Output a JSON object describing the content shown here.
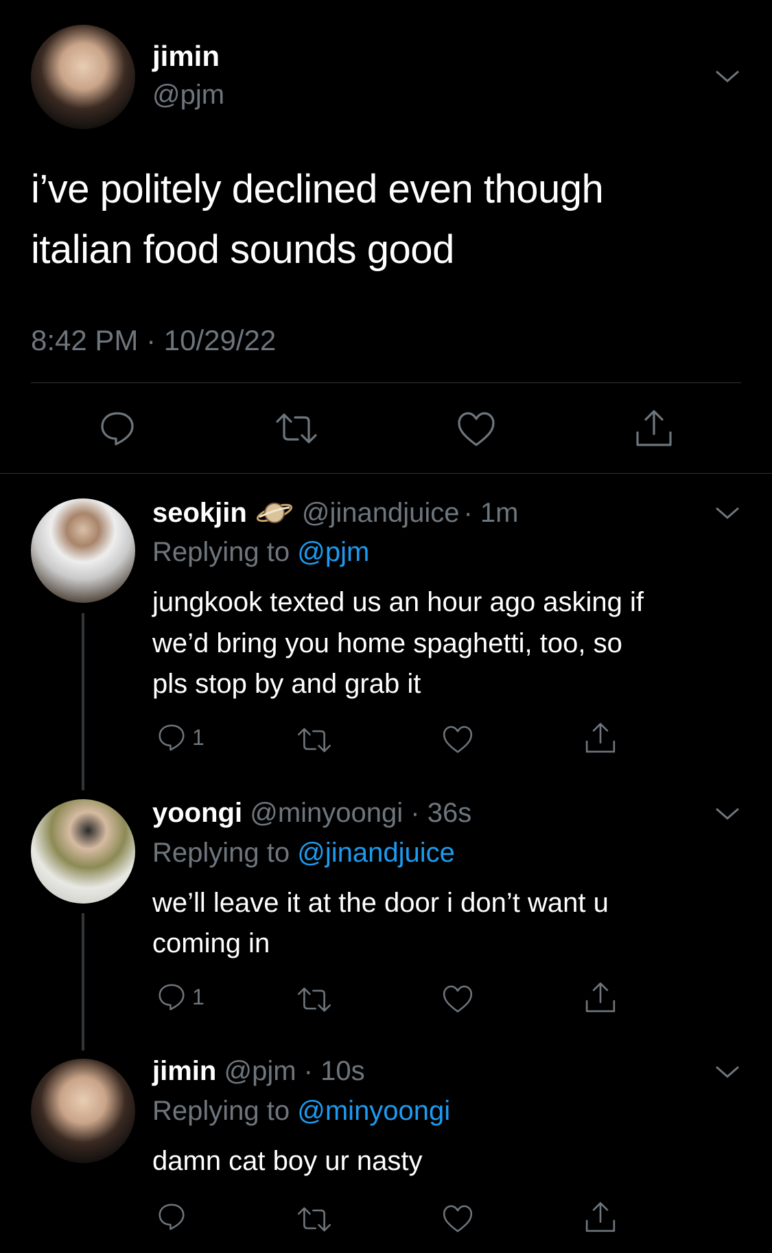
{
  "main_tweet": {
    "name": "jimin",
    "handle": "@pjm",
    "text_line1": "i’ve politely declined even though",
    "text_line2": "italian food sounds good",
    "timestamp": "8:42 PM · 10/29/22"
  },
  "replies": [
    {
      "name": "seokjin",
      "handle": "@jinandjuice",
      "time": "· 1m",
      "replying_label": "Replying to",
      "replying_to": "@pjm",
      "text_line1": "jungkook texted us an hour ago asking if",
      "text_line2": "we’d bring you home spaghetti, too, so",
      "text_line3": "pls stop by and grab it",
      "reply_count": "1",
      "badge_icon": "saturn-icon"
    },
    {
      "name": "yoongi",
      "handle": "@minyoongi",
      "time": "· 36s",
      "replying_label": "Replying to",
      "replying_to": "@jinandjuice",
      "text_line1": "we’ll leave it at the door i don’t want u",
      "text_line2": "coming in",
      "reply_count": "1"
    },
    {
      "name": "jimin",
      "handle": "@pjm",
      "time": "· 10s",
      "replying_label": "Replying to",
      "replying_to": "@minyoongi",
      "text_line1": "damn cat boy ur nasty"
    }
  ],
  "icons": {
    "reply": "speech-bubble-icon",
    "retweet": "retweet-icon",
    "like": "heart-icon",
    "share": "share-icon",
    "more": "chevron-down-icon"
  },
  "colors": {
    "background": "#000000",
    "muted": "#6e767d",
    "link": "#1d9bf0",
    "text": "#ffffff"
  }
}
